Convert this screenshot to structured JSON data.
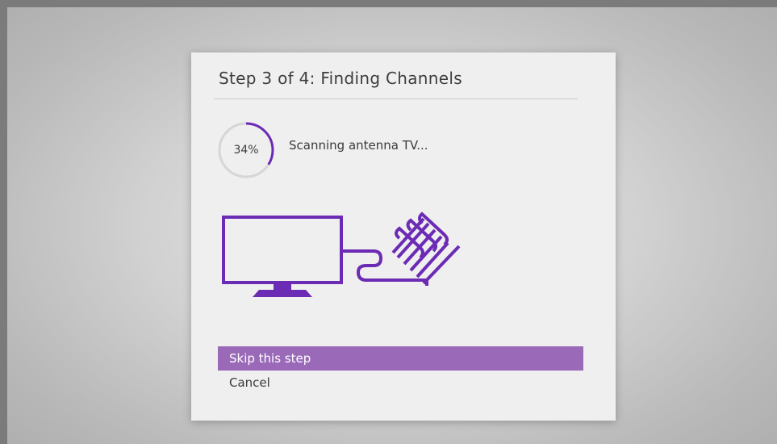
{
  "dialog": {
    "title": "Step 3 of 4: Finding Channels"
  },
  "progress": {
    "value": 34,
    "label": "34%",
    "status": "Scanning antenna TV..."
  },
  "illustration": {
    "icon": "tv-antenna-icon"
  },
  "menu": {
    "items": [
      {
        "label": "Skip this step",
        "selected": true
      },
      {
        "label": "Cancel",
        "selected": false
      }
    ]
  },
  "colors": {
    "accent": "#6c2bb5",
    "selected_bg": "#9a6ab8",
    "ring_track": "#d6d6d6",
    "dialog_bg": "#efefef"
  }
}
